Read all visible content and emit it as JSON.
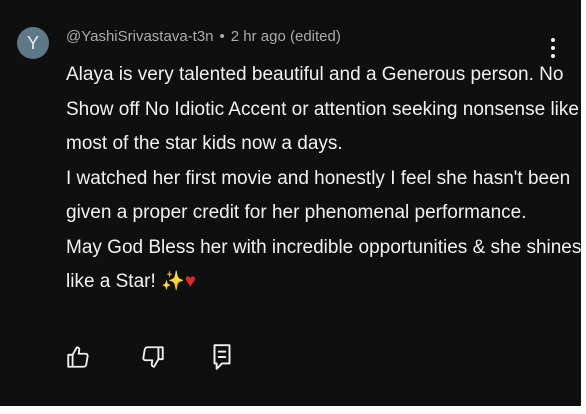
{
  "comment": {
    "avatar_letter": "Y",
    "avatar_color": "#5f7888",
    "author": "@YashiSrivastava-t3n",
    "separator": "•",
    "time": "2 hr ago (edited)",
    "body_lines": [
      "Alaya is very talented beautiful and a Generous person. No",
      "Show off No Idiotic Accent or attention seeking nonsense like",
      "most of the star kids now a days.",
      "I watched her first movie and honestly I feel she hasn't been",
      "given a proper credit for her phenomenal performance.",
      "May God Bless her with incredible opportunities & she shines",
      "like a Star!"
    ],
    "emojis": {
      "sparkles": "✨",
      "heart": "♥"
    }
  },
  "actions": {
    "like_icon": "thumbs-up-icon",
    "dislike_icon": "thumbs-down-icon",
    "reply_icon": "reply-icon"
  },
  "colors": {
    "background": "#0f0f0f",
    "text": "#f1f1f1",
    "meta_text": "#aaaaaa",
    "heart": "#e0262f"
  }
}
